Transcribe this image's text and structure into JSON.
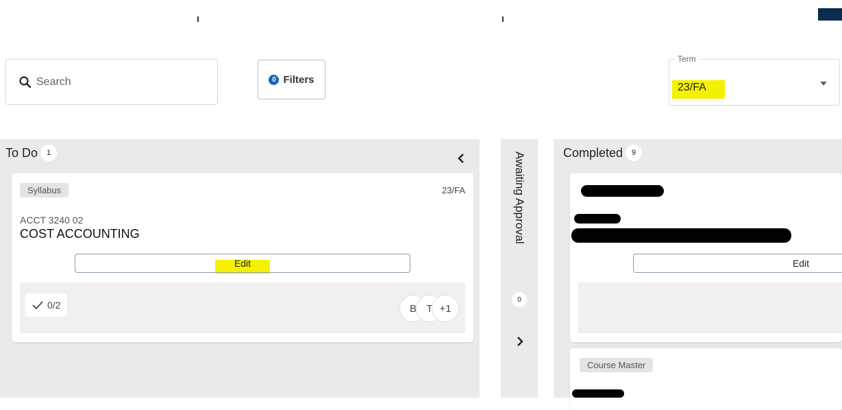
{
  "search": {
    "placeholder": "Search"
  },
  "filters": {
    "count": "0",
    "label": "Filters"
  },
  "term": {
    "legend": "Term",
    "value": "23/FA"
  },
  "columns": {
    "todo": {
      "title": "To Do",
      "count": "1",
      "card": {
        "chip": "Syllabus",
        "term": "23/FA",
        "course_code": "ACCT 3240 02",
        "course_name": "COST ACCOUNTING",
        "edit_label": "Edit",
        "progress": "0/2",
        "avatars": [
          "B",
          "T",
          "+1"
        ]
      }
    },
    "awaiting": {
      "title": "Awaiting Approval",
      "count": "0"
    },
    "completed": {
      "title": "Completed",
      "count": "9",
      "card1": {
        "edit_label": "Edit"
      },
      "card2": {
        "chip": "Course Master"
      }
    }
  },
  "colors": {
    "accent": "#1565c0",
    "highlight": "#f5f000",
    "column_bg": "#ece9e9",
    "top_button": "#0b2d4e"
  },
  "icons": [
    "search-icon",
    "chevron-left-icon",
    "chevron-right-icon",
    "check-icon",
    "dropdown-caret-icon"
  ]
}
